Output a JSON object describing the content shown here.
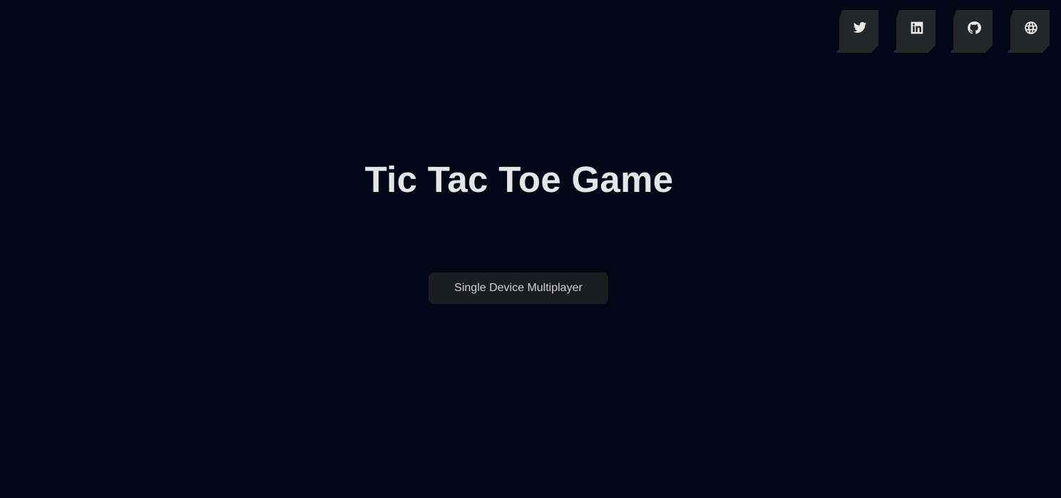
{
  "app": {
    "title": "Tic Tac Toe Game"
  },
  "social_links": [
    {
      "name": "twitter",
      "icon": "twitter-icon"
    },
    {
      "name": "linkedin",
      "icon": "linkedin-icon"
    },
    {
      "name": "github",
      "icon": "github-icon"
    },
    {
      "name": "website",
      "icon": "globe-icon"
    }
  ],
  "menu": {
    "single_device_label": "Single Device Multiplayer"
  },
  "colors": {
    "background": "#020617",
    "button_bg": "#1c1d20",
    "social_bg": "#252628",
    "title_text": "#e5e5e5"
  }
}
